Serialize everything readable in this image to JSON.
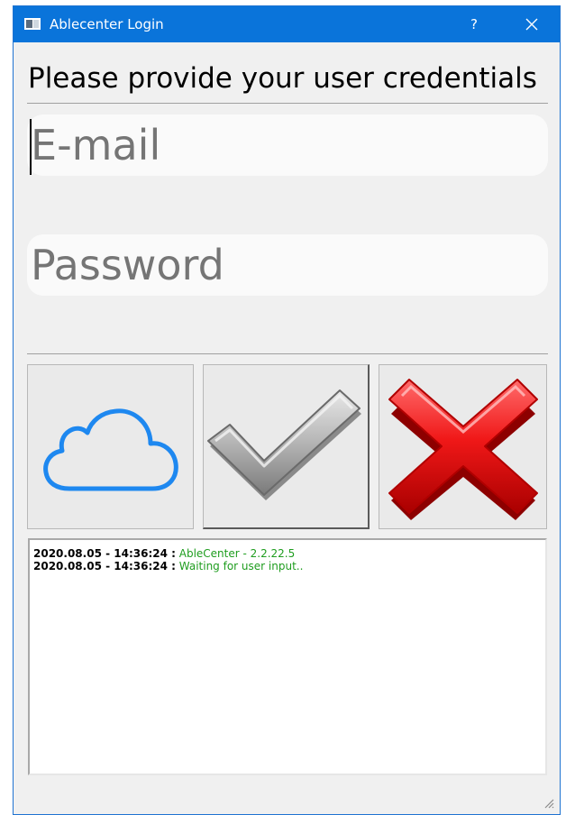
{
  "window": {
    "title": "Ablecenter Login",
    "help_label": "?",
    "accent": "#0a74da"
  },
  "prompt": "Please provide your user credentials",
  "email": {
    "placeholder": "E-mail",
    "value": ""
  },
  "password": {
    "placeholder": "Password",
    "value": ""
  },
  "buttons": {
    "cloud_icon": "cloud-icon",
    "confirm_icon": "checkmark-icon",
    "cancel_icon": "red-x-icon"
  },
  "log": {
    "lines": [
      {
        "timestamp": "2020.08.05 - 14:36:24 :",
        "message": "AbleCenter - 2.2.22.5"
      },
      {
        "timestamp": "2020.08.05 - 14:36:24 :",
        "message": "Waiting for user input.."
      }
    ],
    "message_color": "#1f9d1f"
  }
}
